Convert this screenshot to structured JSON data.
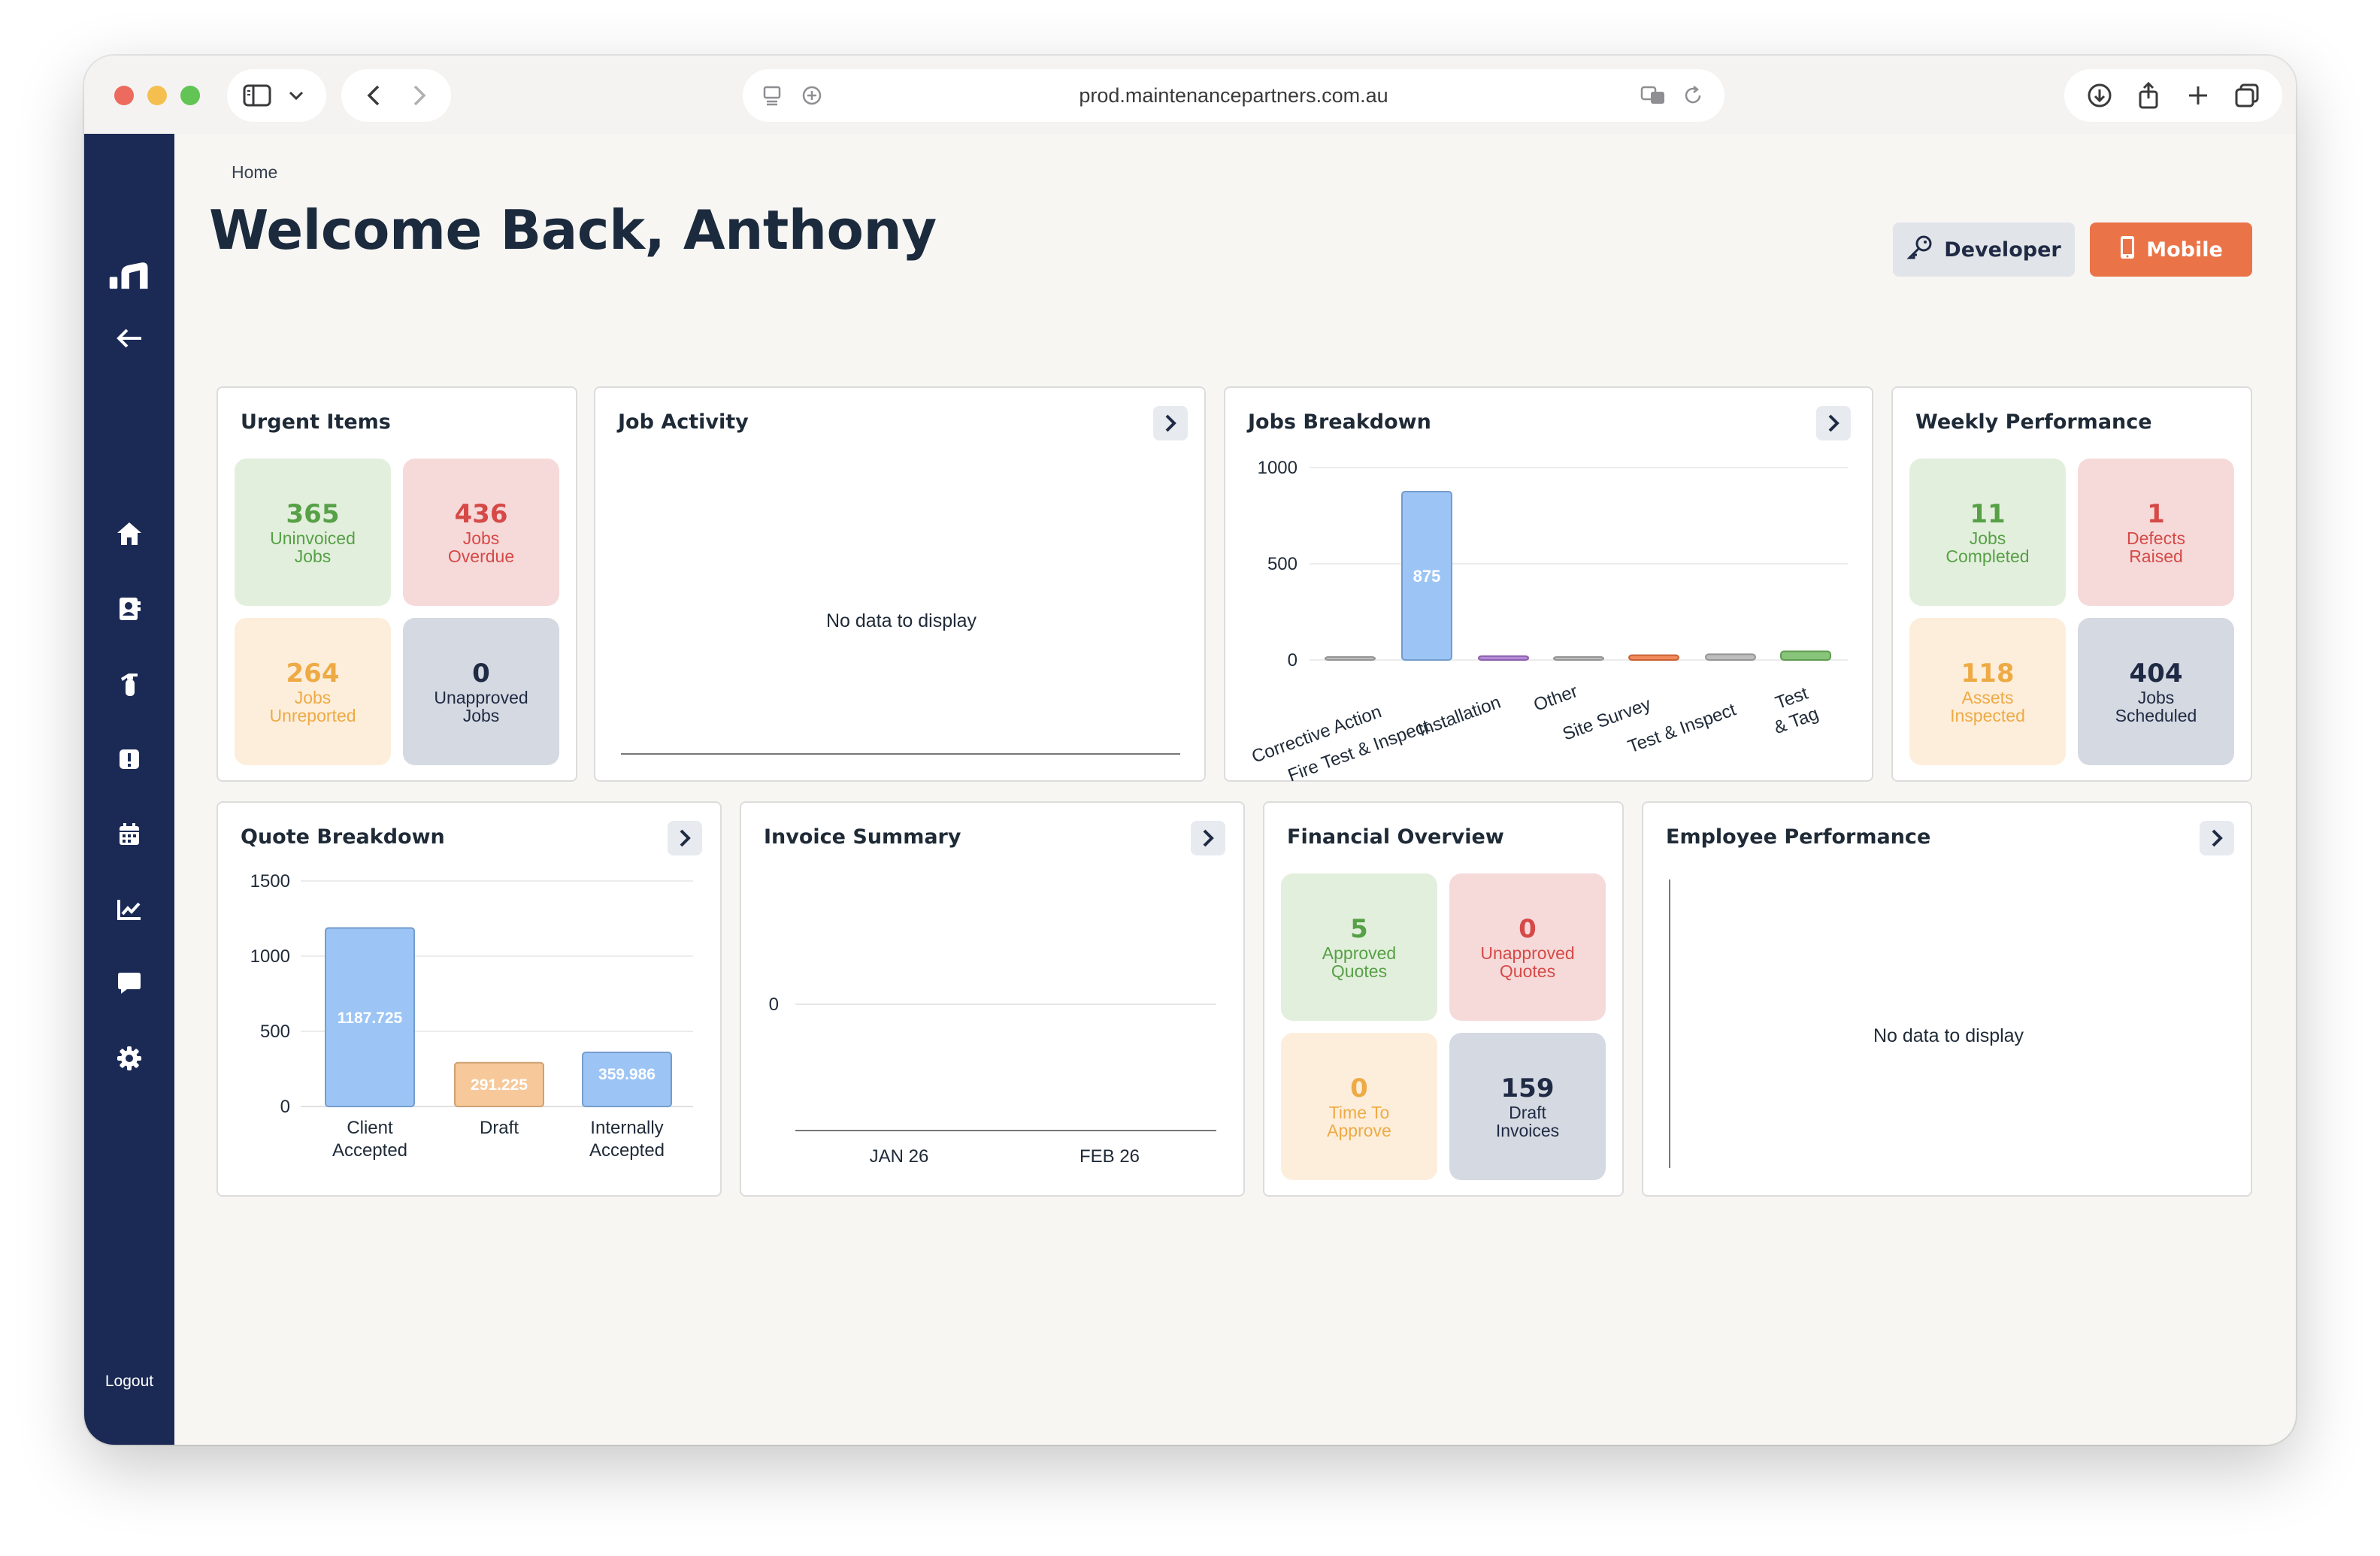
{
  "browser": {
    "url": "prod.maintenancepartners.com.au"
  },
  "sidebar": {
    "items": [
      {
        "name": "logo",
        "icon": "logo-bars-icon"
      },
      {
        "name": "back",
        "icon": "arrow-left-icon"
      },
      {
        "name": "home",
        "icon": "home-icon"
      },
      {
        "name": "contacts",
        "icon": "contact-card-icon"
      },
      {
        "name": "extinguisher",
        "icon": "fire-extinguisher-icon"
      },
      {
        "name": "alerts",
        "icon": "alert-icon"
      },
      {
        "name": "calendar",
        "icon": "calendar-icon"
      },
      {
        "name": "reports",
        "icon": "chart-line-icon"
      },
      {
        "name": "messages",
        "icon": "chat-icon"
      },
      {
        "name": "settings",
        "icon": "gear-icon"
      }
    ],
    "logout_label": "Logout"
  },
  "header": {
    "breadcrumb": "Home",
    "title": "Welcome Back, Anthony",
    "developer_label": "Developer",
    "mobile_label": "Mobile"
  },
  "colors": {
    "sidebar": "#1b2a55",
    "accent": "#ea7448",
    "green": "#56a046",
    "red": "#d54a47",
    "orange": "#eeaa45",
    "slate": "#1f2a44",
    "bar_blue": "#9cc5f5"
  },
  "urgent_items": {
    "title": "Urgent Items",
    "tiles": [
      {
        "value": "365",
        "label1": "Uninvoiced",
        "label2": "Jobs"
      },
      {
        "value": "436",
        "label1": "Jobs",
        "label2": "Overdue"
      },
      {
        "value": "264",
        "label1": "Jobs",
        "label2": "Unreported"
      },
      {
        "value": "0",
        "label1": "Unapproved",
        "label2": "Jobs"
      }
    ]
  },
  "job_activity": {
    "title": "Job Activity",
    "no_data": "No data to display"
  },
  "jobs_breakdown": {
    "title": "Jobs Breakdown",
    "y_ticks": [
      "1000",
      "500",
      "0"
    ],
    "x_labels": [
      "Corrective Action",
      "Fire Test & Inspect",
      "Installation",
      "Other",
      "Site Survey",
      "Test & Inspect",
      "Test",
      "& Tag"
    ],
    "bar_label": "875"
  },
  "weekly_performance": {
    "title": "Weekly Performance",
    "tiles": [
      {
        "value": "11",
        "label1": "Jobs",
        "label2": "Completed"
      },
      {
        "value": "1",
        "label1": "Defects",
        "label2": "Raised"
      },
      {
        "value": "118",
        "label1": "Assets",
        "label2": "Inspected"
      },
      {
        "value": "404",
        "label1": "Jobs",
        "label2": "Scheduled"
      }
    ]
  },
  "quote_breakdown": {
    "title": "Quote Breakdown",
    "y_ticks": [
      "1500",
      "1000",
      "500",
      "0"
    ],
    "cat_labels": [
      [
        "Client",
        "Accepted"
      ],
      [
        "Draft",
        ""
      ],
      [
        "Internally",
        "Accepted"
      ]
    ],
    "bar_labels": [
      "1187.725",
      "291.225",
      "359.986"
    ]
  },
  "invoice_summary": {
    "title": "Invoice Summary",
    "y_tick": "0",
    "x_labels": [
      "JAN 26",
      "FEB 26"
    ]
  },
  "financial_overview": {
    "title": "Financial Overview",
    "tiles": [
      {
        "value": "5",
        "label1": "Approved",
        "label2": "Quotes"
      },
      {
        "value": "0",
        "label1": "Unapproved",
        "label2": "Quotes"
      },
      {
        "value": "0",
        "label1": "Time To",
        "label2": "Approve"
      },
      {
        "value": "159",
        "label1": "Draft",
        "label2": "Invoices"
      }
    ]
  },
  "employee_performance": {
    "title": "Employee Performance",
    "no_data": "No data to display"
  },
  "chart_data": [
    {
      "type": "bar",
      "title": "Jobs Breakdown",
      "categories": [
        "Corrective Action",
        "Fire Test & Inspect",
        "Installation",
        "Other",
        "Site Survey",
        "Test & Inspect",
        "Test & Tag"
      ],
      "values": [
        5,
        875,
        20,
        3,
        25,
        30,
        45
      ],
      "colors": [
        "#bdbdbd",
        "#9cc5f5",
        "#b48ad6",
        "#bdbdbd",
        "#f08a5d",
        "#bdbdbd",
        "#88c57a"
      ],
      "ylim": [
        0,
        1000
      ]
    },
    {
      "type": "bar",
      "title": "Quote Breakdown",
      "categories": [
        "Client Accepted",
        "Draft",
        "Internally Accepted"
      ],
      "values": [
        1187.725,
        291.225,
        359.986
      ],
      "colors": [
        "#9cc5f5",
        "#f7c99a",
        "#9cc5f5"
      ],
      "ylim": [
        0,
        1500
      ]
    },
    {
      "type": "line",
      "title": "Invoice Summary",
      "x": [
        "JAN 26",
        "FEB 26"
      ],
      "series": [],
      "ylim": [
        0,
        0
      ]
    }
  ]
}
